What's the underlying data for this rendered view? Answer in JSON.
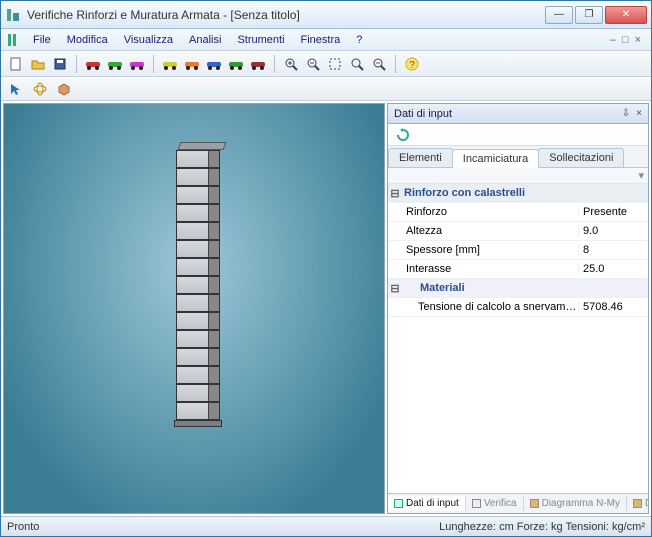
{
  "window": {
    "title": "Verifiche Rinforzi e Muratura Armata - [Senza titolo]"
  },
  "menu": {
    "items": [
      "File",
      "Modifica",
      "Visualizza",
      "Analisi",
      "Strumenti",
      "Finestra",
      "?"
    ],
    "sub_minimize": "–",
    "sub_restore": "□",
    "sub_close": "×"
  },
  "panel": {
    "title": "Dati di input",
    "tabs": {
      "elementi": "Elementi",
      "incamiciatura": "Incamiciatura",
      "sollecitazioni": "Sollecitazioni"
    },
    "group1": "Rinforzo con calastrelli",
    "rows": {
      "rinforzo_k": "Rinforzo",
      "rinforzo_v": "Presente",
      "altezza_k": "Altezza",
      "altezza_v": "9.0",
      "spessore_k": "Spessore [mm]",
      "spessore_v": "8",
      "interasse_k": "Interasse",
      "interasse_v": "25.0"
    },
    "group2": "Materiali",
    "mat_row_k": "Tensione di calcolo a snervamento dell'acci...",
    "mat_row_v": "5708.46"
  },
  "bottom_tabs": {
    "t1": "Dati di input",
    "t2": "Verifica",
    "t3": "Diagramma N-My",
    "t4": "Diagramma N-Mz"
  },
  "status": {
    "left": "Pronto",
    "right": "Lunghezze: cm  Forze: kg  Tensioni: kg/cm²"
  },
  "icons": {
    "minimize": "—",
    "maximize": "❐",
    "close": "✕",
    "pin": "📌",
    "x": "×"
  }
}
